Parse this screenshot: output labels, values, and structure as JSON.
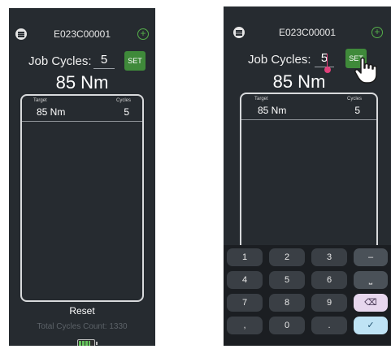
{
  "screens": [
    {
      "device_id": "E023C00001",
      "job_cycles_label": "Job Cycles:",
      "job_cycles_value": "5",
      "set_label": "SET",
      "torque": "85 Nm",
      "table": {
        "target_header": "Target",
        "cycles_header": "Cycles",
        "target_value": "85 Nm",
        "cycles_value": "5"
      },
      "reset_label": "Reset",
      "total_cycles": "Total Cycles Count: 1330",
      "battery_level": 0.85
    },
    {
      "device_id": "E023C00001",
      "job_cycles_label": "Job Cycles:",
      "job_cycles_value": "5",
      "set_label": "SET",
      "torque": "85 Nm",
      "table": {
        "target_header": "Target",
        "cycles_header": "Cycles",
        "target_value": "85 Nm",
        "cycles_value": "5"
      },
      "keypad": {
        "rows": [
          [
            "1",
            "2",
            "3",
            "–"
          ],
          [
            "4",
            "5",
            "6",
            "⎵"
          ],
          [
            "7",
            "8",
            "9",
            "⌫"
          ],
          [
            ",",
            "0",
            ".",
            "✓"
          ]
        ]
      }
    }
  ],
  "icons": {
    "menu": "menu-icon",
    "add": "add-circle-icon",
    "battery": "battery-icon",
    "hand": "hand-pointer-icon"
  },
  "colors": {
    "background": "#262b30",
    "accent_green": "#3f8a3a",
    "cursor_pink": "#e0407a",
    "done_key": "#bfe3f5",
    "backspace_key": "#e7d7ee"
  }
}
